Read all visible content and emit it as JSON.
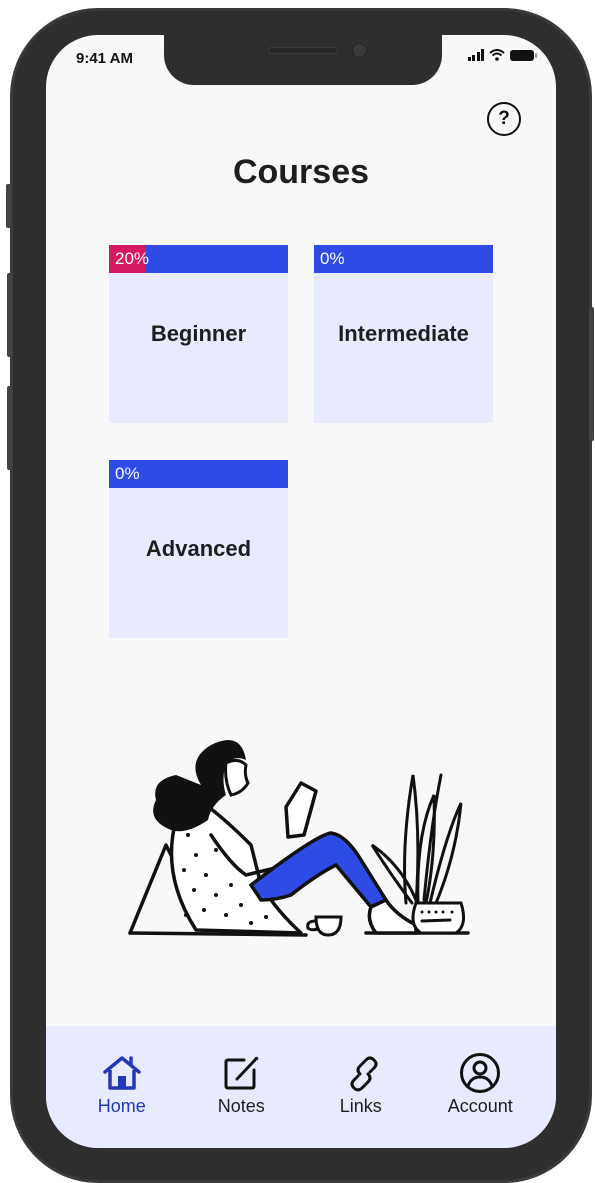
{
  "status_bar": {
    "time": "9:41 AM"
  },
  "header": {
    "title": "Courses",
    "help_icon_label": "?"
  },
  "courses": [
    {
      "name": "Beginner",
      "progress_label": "20%",
      "progress": 0.2
    },
    {
      "name": "Intermediate",
      "progress_label": "0%",
      "progress": 0.0
    },
    {
      "name": "Advanced",
      "progress_label": "0%",
      "progress": 0.0
    }
  ],
  "illustration": {
    "description": "woman-reading-with-plant"
  },
  "tabbar": {
    "items": [
      {
        "label": "Home",
        "icon": "home-icon",
        "active": true
      },
      {
        "label": "Notes",
        "icon": "edit-icon",
        "active": false
      },
      {
        "label": "Links",
        "icon": "link-icon",
        "active": false
      },
      {
        "label": "Account",
        "icon": "account-icon",
        "active": false
      }
    ]
  },
  "colors": {
    "accent": "#2e4be6",
    "progress_fill": "#d61a62",
    "card_bg": "#e8eafd",
    "active_tab": "#2238b5"
  }
}
